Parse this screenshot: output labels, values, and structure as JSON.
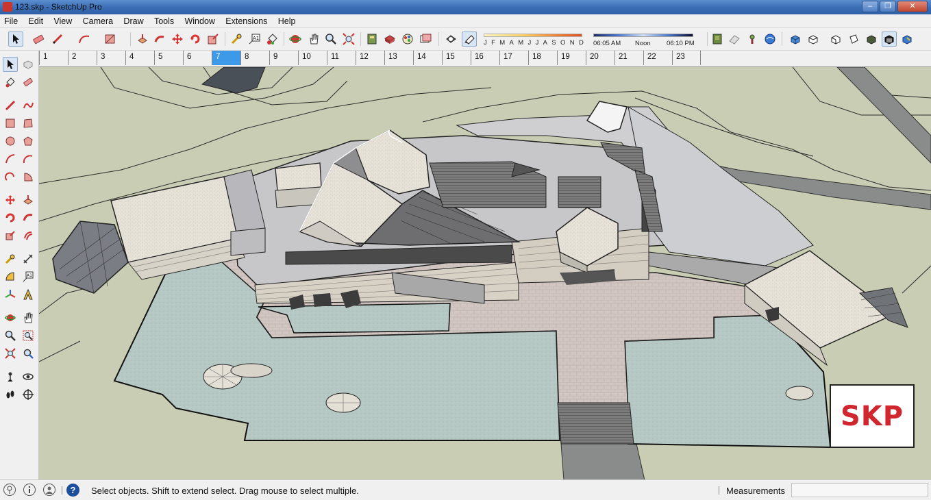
{
  "window": {
    "title": "123.skp - SketchUp Pro",
    "minimize_glyph": "–",
    "maximize_glyph": "❐",
    "close_glyph": "✕"
  },
  "menu": [
    "File",
    "Edit",
    "View",
    "Camera",
    "Draw",
    "Tools",
    "Window",
    "Extensions",
    "Help"
  ],
  "toolbar": {
    "icons": [
      "select-arrow",
      "eraser",
      "pencil-line",
      "freehand",
      "rectangle",
      "push-pull",
      "follow-me",
      "move",
      "rotate",
      "scale",
      "tape-measure",
      "text",
      "paint-bucket",
      "orbit",
      "pan",
      "zoom",
      "zoom-extents",
      "model-info",
      "components",
      "materials",
      "styles",
      "section",
      "xray-display",
      "shadow-toggle"
    ],
    "months": [
      "J",
      "F",
      "M",
      "A",
      "M",
      "J",
      "J",
      "A",
      "S",
      "O",
      "N",
      "D"
    ],
    "time_start": "06:05 AM",
    "time_noon": "Noon",
    "time_end": "06:10 PM",
    "view_icons": [
      "get-models",
      "share-model",
      "add-location",
      "geo-location",
      "iso-view",
      "top-view",
      "front-view",
      "right-view",
      "back-view",
      "left-view",
      "bottom-view"
    ]
  },
  "timeline": {
    "labels": [
      "1",
      "2",
      "3",
      "4",
      "5",
      "6",
      "7",
      "8",
      "9",
      "10",
      "11",
      "12",
      "13",
      "14",
      "15",
      "16",
      "17",
      "18",
      "19",
      "20",
      "21",
      "22",
      "23"
    ],
    "active": "7"
  },
  "left_tools": [
    "select",
    "component",
    "paint",
    "eraser",
    "line",
    "freehand",
    "rectangle",
    "rotated-rectangle",
    "circle",
    "polygon",
    "arc",
    "two-point-arc",
    "three-point-arc",
    "pie",
    "move",
    "push-pull",
    "rotate",
    "follow-me",
    "scale",
    "offset",
    "tape-measure",
    "dimension",
    "protractor",
    "text",
    "axes",
    "3d-text",
    "orbit",
    "pan",
    "zoom",
    "zoom-window",
    "zoom-extents",
    "previous-view",
    "position-camera",
    "look-around",
    "walk",
    "section-plane"
  ],
  "badge": {
    "text": "SKP"
  },
  "status": {
    "message": "Select objects. Shift to extend select. Drag mouse to select multiple.",
    "help_glyph": "?",
    "measurements_label": "Measurements",
    "measurements_value": ""
  },
  "colors": {
    "accent": "#3d9ae8",
    "terrain": "#c9cdb3",
    "water": "#b5c7c2",
    "paving": "#d0c4c2",
    "roof": "#e4e0d6",
    "badge_text": "#d0262e"
  }
}
